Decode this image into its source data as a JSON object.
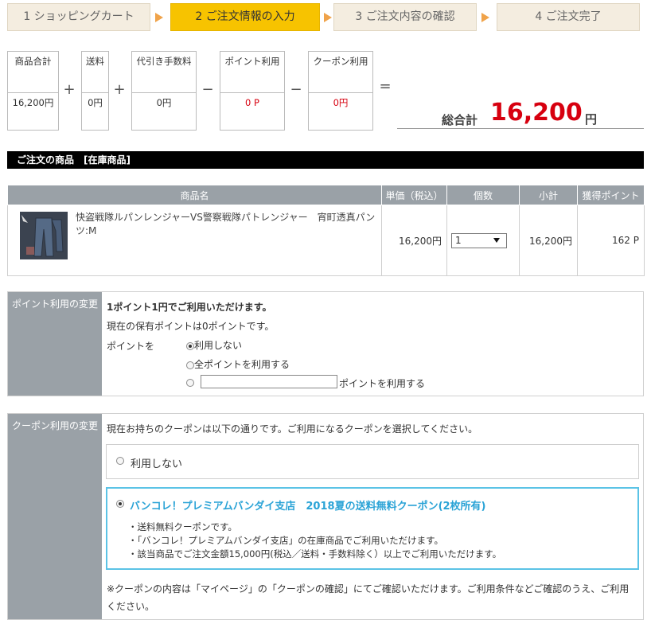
{
  "steps": [
    {
      "label": "1 ショッピングカート"
    },
    {
      "label": "2 ご注文情報の入力"
    },
    {
      "label": "3 ご注文内容の確認"
    },
    {
      "label": "4 ご注文完了"
    }
  ],
  "totals": {
    "items": [
      {
        "label": "商品合計",
        "value": "16,200円"
      },
      {
        "label": "送料",
        "value": "0円"
      },
      {
        "label": "代引き手数料",
        "value": "0円"
      },
      {
        "label": "ポイント利用",
        "value": "0 P"
      },
      {
        "label": "クーポン利用",
        "value": "0円"
      }
    ],
    "ops": [
      "+",
      "+",
      "−",
      "−",
      "="
    ],
    "grand_label": "総合計",
    "grand_amount": "16,200",
    "grand_unit": "円"
  },
  "section_title": "ご注文の商品　[在庫商品]",
  "product_table": {
    "headers": [
      "商品名",
      "単価（税込）",
      "個数",
      "小計",
      "獲得ポイント"
    ],
    "row": {
      "name": "快盗戦隊ルパンレンジャーVS警察戦隊パトレンジャー　宵町透真パンツ:M",
      "price": "16,200円",
      "qty": "1",
      "subtotal": "16,200円",
      "points": "162 P"
    }
  },
  "point_panel": {
    "side_label": "ポイント利用の変更",
    "headline": "1ポイント1円でご利用いただけます。",
    "current": "現在の保有ポイントは0ポイントです。",
    "field_label": "ポイントを",
    "opt_none": "利用しない",
    "opt_all": "全ポイントを利用する",
    "opt_custom_suffix": "ポイントを利用する"
  },
  "coupon_panel": {
    "side_label": "クーポン利用の変更",
    "intro": "現在お持ちのクーポンは以下の通りです。ご利用になるクーポンを選択してください。",
    "opt_none": "利用しない",
    "coupon_title": "バンコレ！プレミアムバンダイ支店　2018夏の送料無料クーポン(2枚所有)",
    "coupon_lines": [
      "・送料無料クーポンです。",
      "・「バンコレ！プレミアムバンダイ支店」の在庫商品でご利用いただけます。",
      "・該当商品でご注文金額15,000円(税込／送料・手数料除く）以上でご利用いただけます。"
    ],
    "note_line1": "※クーポンの内容は「マイページ」の「クーポンの確認」にてご確認いただけます。ご利用条件などご確認のうえ、ご利用",
    "note_line2": "ください。"
  },
  "colors": {
    "step_active": "#f7c300",
    "step_inactive": "#f4ede0",
    "step_arrow": "#f0a34a",
    "price_red": "#d7000f",
    "header_gray": "#9aa1a7",
    "coupon_blue": "#5bc3e6"
  }
}
